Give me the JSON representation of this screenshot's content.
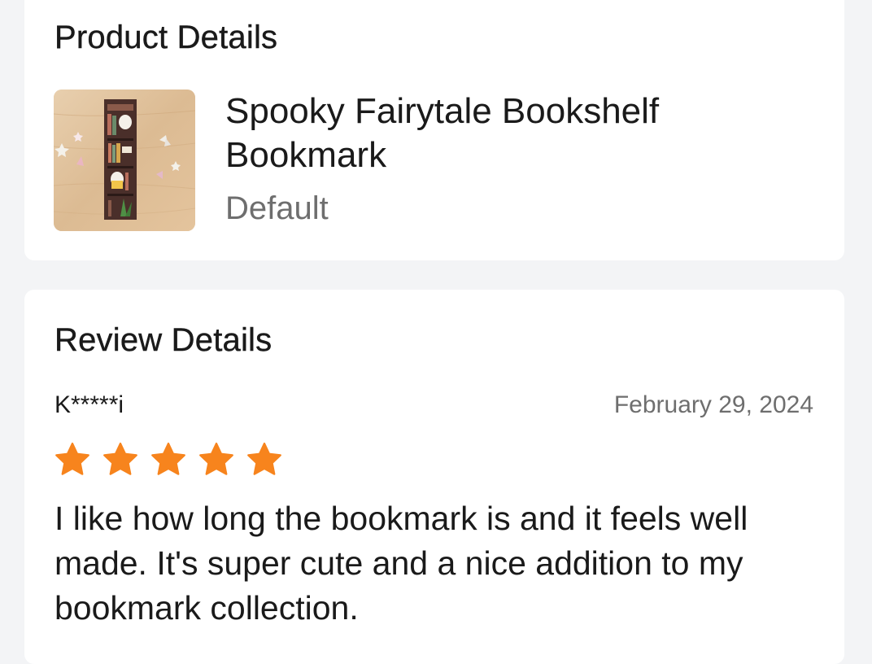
{
  "product_section": {
    "title": "Product Details",
    "product": {
      "name": "Spooky Fairytale Bookshelf Bookmark",
      "variant": "Default",
      "image_alt": "bookmark-photo"
    }
  },
  "review_section": {
    "title": "Review Details",
    "reviewer": "K*****i",
    "date": "February 29, 2024",
    "rating": 5,
    "rating_max": 5,
    "text": "I like how long the bookmark is and it feels well made. It's super cute and a nice addition to my bookmark collection."
  },
  "colors": {
    "page_background": "#f3f4f6",
    "card_background": "#ffffff",
    "star": "#f7841d",
    "muted_text": "#6e6e6e"
  },
  "icons": {
    "star": "star-icon"
  }
}
